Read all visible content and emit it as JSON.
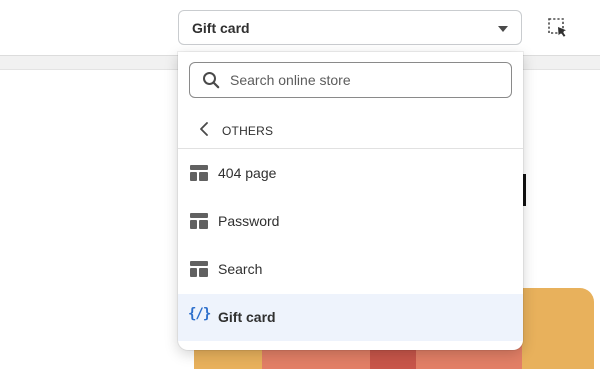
{
  "toolbar": {
    "template_select_value": "Gift card",
    "inspector_icon": "select-element-icon"
  },
  "dropdown": {
    "search_placeholder": "Search online store",
    "search_value": "",
    "back_label": "OTHERS",
    "items": [
      {
        "label": "404 page",
        "icon": "layout-template-icon",
        "selected": false
      },
      {
        "label": "Password",
        "icon": "layout-template-icon",
        "selected": false
      },
      {
        "label": "Search",
        "icon": "layout-template-icon",
        "selected": false
      },
      {
        "label": "Gift card",
        "icon": "code-braces-icon",
        "selected": true
      }
    ]
  },
  "colors": {
    "accent": "#2c6ecb",
    "selected_bg": "#eef3fc",
    "text": "#303030",
    "preview_card": "#e8b15c",
    "preview_ribbon": "#e27f66"
  }
}
